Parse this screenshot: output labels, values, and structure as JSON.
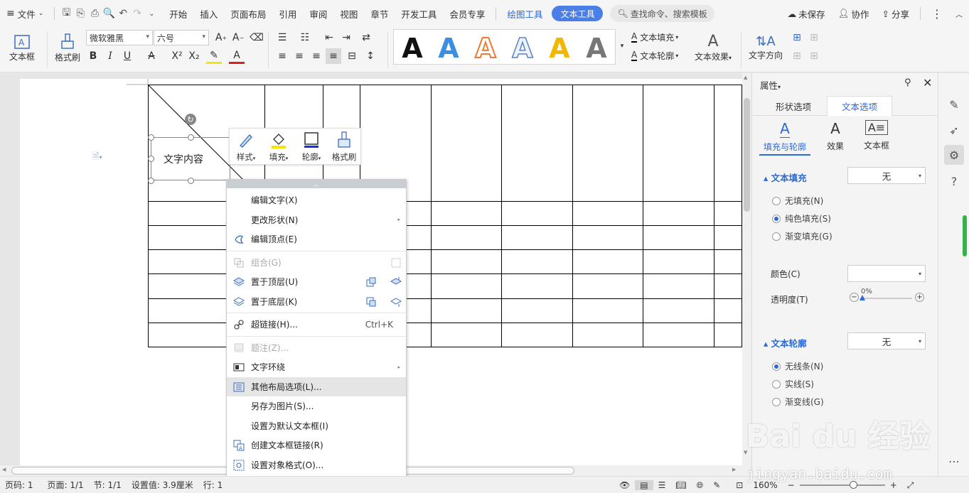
{
  "menubar": {
    "file": "文件",
    "tabs": [
      "开始",
      "插入",
      "页面布局",
      "引用",
      "审阅",
      "视图",
      "章节",
      "开发工具",
      "会员专享"
    ],
    "drawing_tools": "绘图工具",
    "text_tools": "文本工具",
    "search_placeholder": "查找命令、搜索模板",
    "unsaved": "未保存",
    "collab": "协作",
    "share": "分享"
  },
  "ribbon": {
    "textbox": "文本框",
    "format_painter": "格式刷",
    "font_name": "微软雅黑",
    "font_size": "六号",
    "text_fill": "文本填充",
    "text_outline": "文本轮廓",
    "text_effect": "文本效果",
    "text_direction": "文字方向",
    "wordart_letter": "A",
    "wordart_colors": [
      "#111111",
      "#3b8ee0",
      "#ef7b32",
      "#e8eefa",
      "#f2b800",
      "#777777"
    ]
  },
  "textbox": {
    "content": "文字内容"
  },
  "mini_toolbar": {
    "items": [
      "样式",
      "填充",
      "轮廓",
      "格式刷"
    ]
  },
  "context_menu": {
    "items": [
      {
        "label": "编辑文字(X)"
      },
      {
        "label": "更改形状(N)"
      },
      {
        "label": "编辑顶点(E)"
      },
      {
        "label": "组合(G)"
      },
      {
        "label": "置于顶层(U)"
      },
      {
        "label": "置于底层(K)"
      },
      {
        "label": "超链接(H)...",
        "shortcut": "Ctrl+K"
      },
      {
        "label": "题注(Z)..."
      },
      {
        "label": "文字环绕"
      },
      {
        "label": "其他布局选项(L)..."
      },
      {
        "label": "另存为图片(S)..."
      },
      {
        "label": "设置为默认文本框(I)"
      },
      {
        "label": "创建文本框链接(R)"
      },
      {
        "label": "设置对象格式(O)..."
      }
    ]
  },
  "panel": {
    "title": "属性",
    "tab_shape": "形状选项",
    "tab_text": "文本选项",
    "sub_fill_outline": "填充与轮廓",
    "sub_effect": "效果",
    "sub_textbox": "文本框",
    "text_fill_head": "文本填充",
    "text_fill_value": "无",
    "fill_none": "无填充(N)",
    "fill_solid": "纯色填充(S)",
    "fill_gradient": "渐变填充(G)",
    "color_label": "颜色(C)",
    "transparency_label": "透明度(T)",
    "transparency_value": "0%",
    "text_outline_head": "文本轮廓",
    "text_outline_value": "无",
    "line_none": "无线条(N)",
    "line_solid": "实线(S)",
    "line_gradient": "渐变线(G)"
  },
  "status": {
    "page_num": "页码: 1",
    "pages": "页面: 1/1",
    "section": "节: 1/1",
    "setting": "设置值: 3.9厘米",
    "row": "行: 1",
    "zoom": "160%"
  },
  "watermark": {
    "brand": "Bai du 经验",
    "url": "jingyan.baidu.com"
  }
}
